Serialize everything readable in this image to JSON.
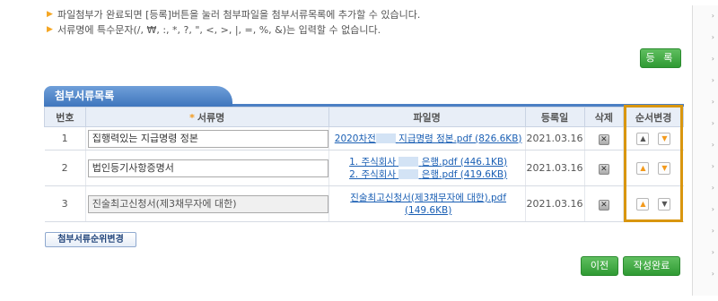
{
  "notices": [
    "파일첨부가 완료되면 [등록]버튼을 눌러 첨부파일을 첨부서류목록에 추가할 수 있습니다.",
    "서류명에 특수문자(/, ₩, :, *, ?, \", <, >, |, =, %, &)는 입력할 수 없습니다."
  ],
  "register_label": "등 록",
  "section_title": "첨부서류목록",
  "columns": {
    "no": "번호",
    "required_mark": "*",
    "doc_name": "서류명",
    "file_name": "파일명",
    "reg_date": "등록일",
    "delete": "삭제",
    "order": "순서변경"
  },
  "rows": [
    {
      "no": "1",
      "doc_name": "집행력있는 지급명령 정본",
      "files": [
        {
          "pre": "2020차전",
          "post": "지급명령 정본.pdf (826.6KB)"
        }
      ],
      "date": "2021.03.16",
      "delete_icon": "delete-x-icon",
      "order_up_active": false,
      "order_down_active": true,
      "editable": true
    },
    {
      "no": "2",
      "doc_name": "법인등기사항증명서",
      "files": [
        {
          "pre": "1. 주식회사",
          "post": "은행.pdf (446.1KB)"
        },
        {
          "pre": "2. 주식회사",
          "post": "은행.pdf (419.6KB)"
        }
      ],
      "date": "2021.03.16",
      "delete_icon": "delete-x-icon",
      "order_up_active": true,
      "order_down_active": true,
      "editable": true
    },
    {
      "no": "3",
      "doc_name": "진술최고신청서(제3채무자에 대한)",
      "files": [
        {
          "pre": "",
          "post": "진술최고신청서(제3채무자에 대한).pdf (149.6KB)"
        }
      ],
      "date": "2021.03.16",
      "delete_icon": "delete-x-icon",
      "order_up_active": true,
      "order_down_active": false,
      "editable": false
    }
  ],
  "order_change_label": "첨부서류순위변경",
  "prev_label": "이전",
  "complete_label": "작성완료",
  "colors": {
    "accent_green": "#2f9a33",
    "header_blue": "#3f76bd",
    "highlight": "#d9960f",
    "link": "#1a5fb4"
  }
}
